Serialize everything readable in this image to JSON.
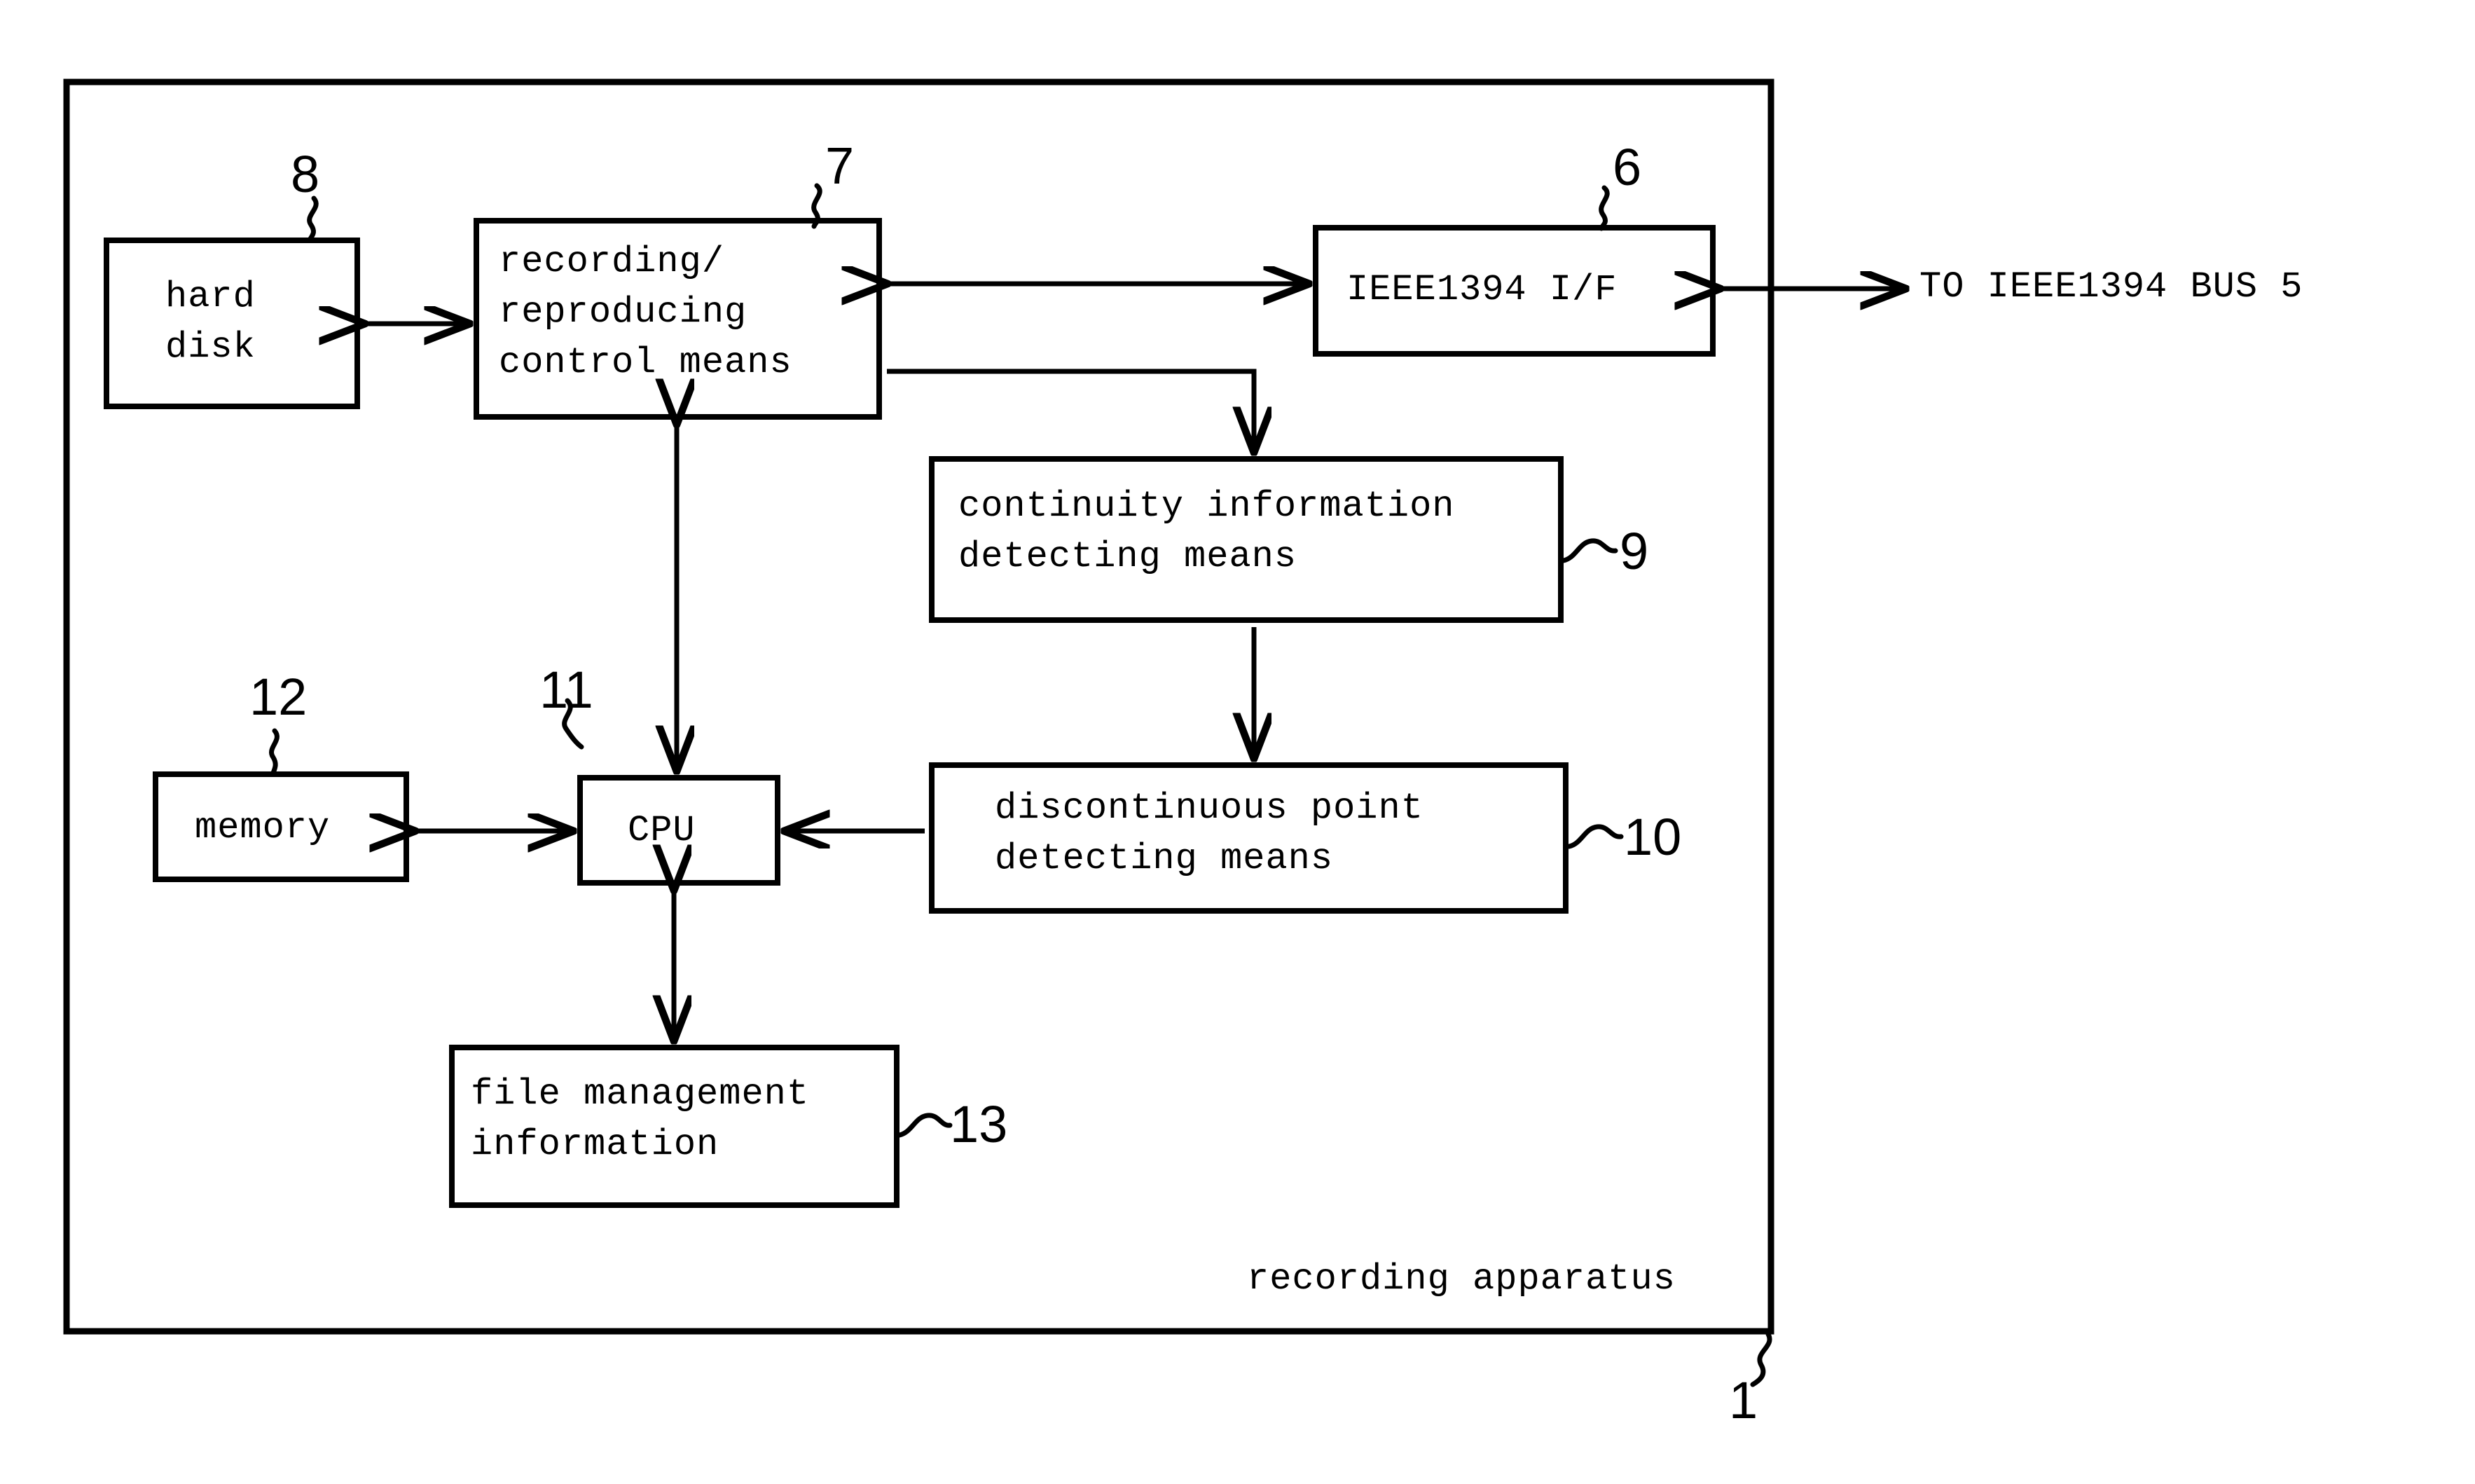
{
  "figure": {
    "kind": "patent-block-diagram",
    "caption": "recording apparatus",
    "outer_ref": "1",
    "ink_color": "#000000",
    "background_color": "#ffffff"
  },
  "blocks": {
    "hard_disk": {
      "line1": "hard",
      "line2": "disk",
      "ref": "8"
    },
    "rec_repro": {
      "line1": "recording/",
      "line2": "reproducing",
      "line3": "control means",
      "ref": "7"
    },
    "ieee1394": {
      "line1": "IEEE1394 I/F",
      "ref": "6"
    },
    "continuity": {
      "line1": "continuity information",
      "line2": "detecting means",
      "ref": "9"
    },
    "discontinuous": {
      "line1": "discontinuous point",
      "line2": "detecting means",
      "ref": "10"
    },
    "memory": {
      "line1": "memory",
      "ref": "12"
    },
    "cpu": {
      "line1": "CPU",
      "ref": "11"
    },
    "file_mgmt": {
      "line1": "file management",
      "line2": "information",
      "ref": "13"
    }
  },
  "external": {
    "bus_label": "TO IEEE1394 BUS 5"
  }
}
